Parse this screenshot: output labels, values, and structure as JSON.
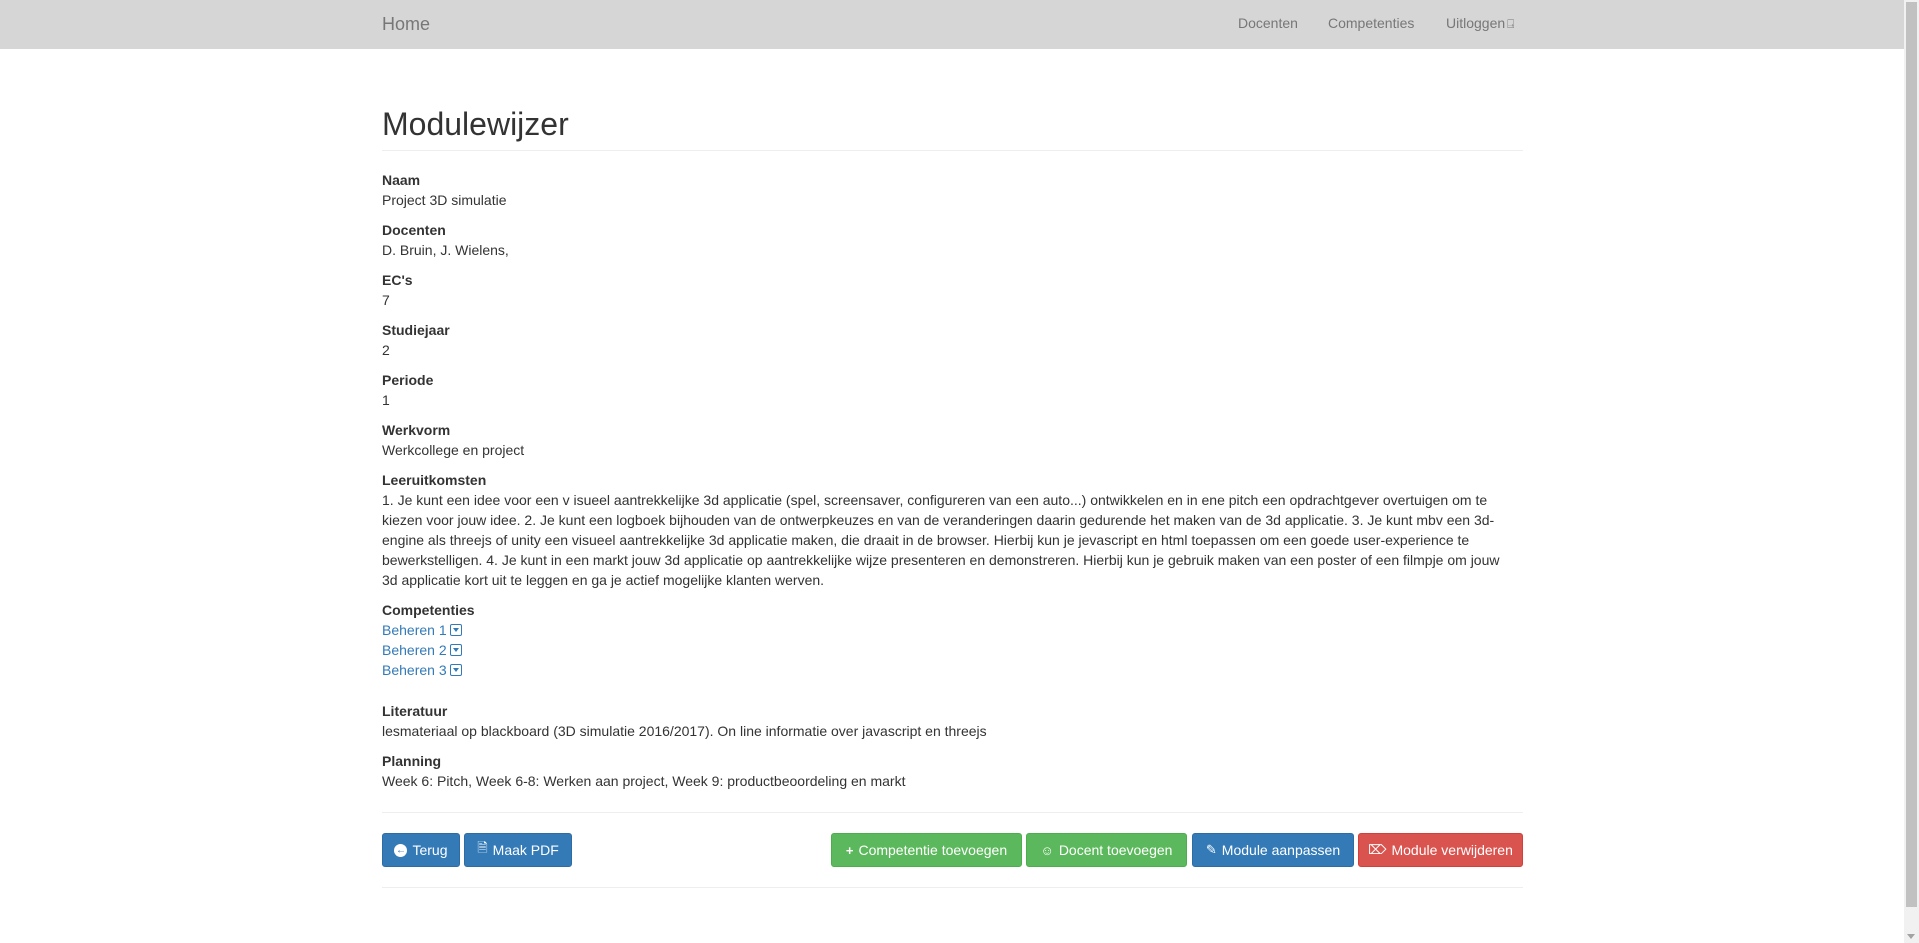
{
  "navbar": {
    "brand": "Home",
    "links": [
      "Docenten",
      "Competenties",
      "Uitloggen"
    ]
  },
  "page": {
    "title": "Modulewijzer"
  },
  "fields": {
    "naam": {
      "label": "Naam",
      "value": "Project 3D simulatie"
    },
    "docenten": {
      "label": "Docenten",
      "value": "D. Bruin, J. Wielens,"
    },
    "ecs": {
      "label": "EC's",
      "value": "7"
    },
    "studiejaar": {
      "label": "Studiejaar",
      "value": "2"
    },
    "periode": {
      "label": "Periode",
      "value": "1"
    },
    "werkvorm": {
      "label": "Werkvorm",
      "value": "Werkcollege en project"
    },
    "leeruitkomsten": {
      "label": "Leeruitkomsten",
      "value": "1. Je kunt een idee voor een v isueel aantrekkelijke 3d applicatie (spel, screensaver, configureren van een auto...) ontwikkelen en in ene pitch een opdrachtgever overtuigen om te kiezen voor jouw idee. 2. Je kunt een logboek bijhouden van de ontwerpkeuzes en van de veranderingen daarin gedurende het maken van de 3d applicatie. 3. Je kunt mbv een 3d-engine als threejs of unity een visueel aantrekkelijke 3d applicatie maken, die draait in de browser. Hierbij kun je jevascript en html toepassen om een goede user-experience te bewerkstelligen. 4. Je kunt in een markt jouw 3d applicatie op aantrekkelijke wijze presenteren en demonstreren. Hierbij kun je gebruik maken van een poster of een filmpje om jouw 3d applicatie kort uit te leggen en ga je actief mogelijke klanten werven."
    },
    "competenties": {
      "label": "Competenties",
      "items": [
        "Beheren 1",
        "Beheren 2",
        "Beheren 3"
      ]
    },
    "literatuur": {
      "label": "Literatuur",
      "value": "lesmateriaal op blackboard (3D simulatie 2016/2017). On line informatie over javascript en threejs"
    },
    "planning": {
      "label": "Planning",
      "value": "Week 6: Pitch, Week 6-8: Werken aan project, Week 9: productbeoordeling en markt"
    }
  },
  "buttons": {
    "terug": "Terug",
    "pdf": "Maak PDF",
    "competentie_toevoegen": "Competentie toevoegen",
    "docent_toevoegen": "Docent toevoegen",
    "module_aanpassen": "Module aanpassen",
    "module_verwijderen": "Module verwijderen"
  },
  "icons": {
    "terug": "arrow-circle-left-icon",
    "pdf": "file-pdf-icon",
    "competentie": "plus-icon",
    "docent": "user-plus-icon",
    "aanpassen": "pencil-icon",
    "verwijderen": "trash-icon",
    "uitloggen": "sign-out-icon",
    "dropdown": "caret-square-down-icon"
  },
  "colors": {
    "primary": "#337ab7",
    "success": "#5cb85c",
    "danger": "#d9534f",
    "navbar": "#d6d6d6"
  }
}
